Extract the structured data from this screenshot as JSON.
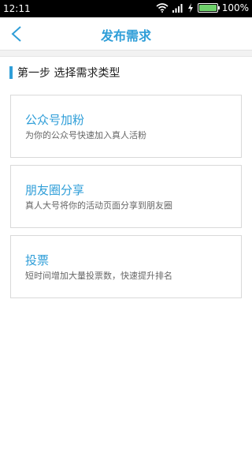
{
  "status_bar": {
    "time": "12:11",
    "battery_text": "100%",
    "icons": [
      "wifi-icon",
      "signal-icon",
      "charge-icon",
      "battery-icon"
    ],
    "battery_level": 1.0
  },
  "header": {
    "title": "发布需求",
    "back_icon": "chevron-left-icon",
    "accent_color": "#2f9ed8"
  },
  "step": {
    "label": "第一步 选择需求类型"
  },
  "options": [
    {
      "title": "公众号加粉",
      "desc": "为你的公众号快速加入真人活粉"
    },
    {
      "title": "朋友圈分享",
      "desc": "真人大号将你的活动页面分享到朋友圈"
    },
    {
      "title": "投票",
      "desc": "短时间增加大量投票数，快速提升排名"
    }
  ]
}
